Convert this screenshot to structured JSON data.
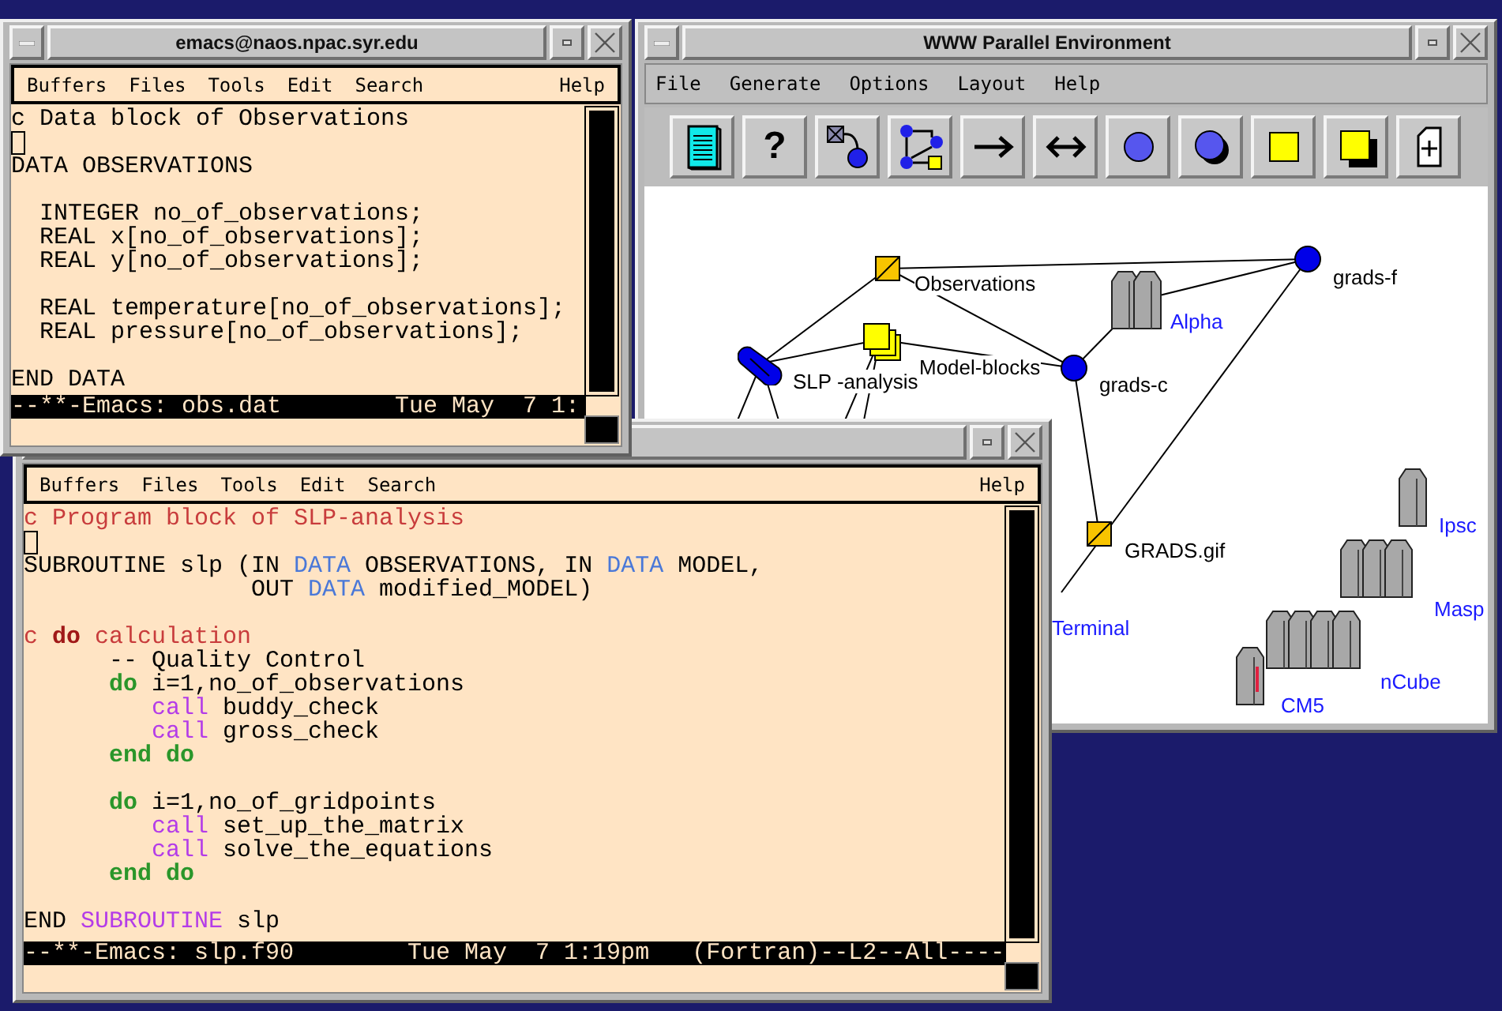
{
  "emacs_top": {
    "title": "emacs@naos.npac.syr.edu",
    "menu": [
      "Buffers",
      "Files",
      "Tools",
      "Edit",
      "Search"
    ],
    "help": "Help",
    "lines": [
      {
        "cursor": false,
        "segments": [
          {
            "kind": "text",
            "text": "c Data block of Observations"
          }
        ]
      },
      {
        "cursor": true
      },
      {
        "cursor": false,
        "segments": [
          {
            "kind": "text",
            "text": "DATA OBSERVATIONS"
          }
        ]
      },
      {
        "cursor": false
      },
      {
        "cursor": false,
        "segments": [
          {
            "kind": "text",
            "text": "  INTEGER no_of_observations;"
          }
        ]
      },
      {
        "cursor": false,
        "segments": [
          {
            "kind": "text",
            "text": "  REAL x[no_of_observations];"
          }
        ]
      },
      {
        "cursor": false,
        "segments": [
          {
            "kind": "text",
            "text": "  REAL y[no_of_observations];"
          }
        ]
      },
      {
        "cursor": false
      },
      {
        "cursor": false,
        "segments": [
          {
            "kind": "text",
            "text": "  REAL temperature[no_of_observations];"
          }
        ]
      },
      {
        "cursor": false,
        "segments": [
          {
            "kind": "text",
            "text": "  REAL pressure[no_of_observations];"
          }
        ]
      },
      {
        "cursor": false
      },
      {
        "cursor": false,
        "segments": [
          {
            "kind": "text",
            "text": "END DATA"
          }
        ]
      }
    ],
    "modeline": "--**-Emacs: obs.dat        Tue May  7 1:"
  },
  "wpe": {
    "title": "WWW Parallel Environment",
    "menu": [
      "File",
      "Generate",
      "Options",
      "Layout",
      "Help"
    ],
    "toolbar": [
      {
        "kind": "document"
      },
      {
        "kind": "help",
        "label": "?"
      },
      {
        "kind": "transform"
      },
      {
        "kind": "tree"
      },
      {
        "kind": "arrow"
      },
      {
        "kind": "double-arrow"
      },
      {
        "kind": "circle"
      },
      {
        "kind": "circle-shadow"
      },
      {
        "kind": "square"
      },
      {
        "kind": "square-shadow"
      },
      {
        "kind": "tag"
      }
    ],
    "nodes": [
      {
        "label": "Observations",
        "kind": "data"
      },
      {
        "label": "grads-f",
        "kind": "module"
      },
      {
        "label": "Alpha",
        "kind": "machine"
      },
      {
        "label": "SLP -analysis",
        "kind": "program"
      },
      {
        "label": "Model-blocks",
        "kind": "datastack"
      },
      {
        "label": "grads-c",
        "kind": "module"
      },
      {
        "label": "GRADS.gif",
        "kind": "data"
      },
      {
        "label": "Ipsc",
        "kind": "machine"
      },
      {
        "label": "Masp",
        "kind": "machine"
      },
      {
        "label": "Terminal",
        "kind": "link"
      },
      {
        "label": "nCube",
        "kind": "machine"
      },
      {
        "label": "CM5",
        "kind": "machine"
      }
    ]
  },
  "emacs_bottom": {
    "menu": [
      "Buffers",
      "Files",
      "Tools",
      "Edit",
      "Search"
    ],
    "help": "Help",
    "lines": [
      {
        "cursor": false,
        "segments": [
          {
            "kind": "comment",
            "text": "c Program block of SLP-analysis"
          }
        ]
      },
      {
        "cursor": true
      },
      {
        "cursor": false,
        "segments": [
          {
            "kind": "text",
            "text": "SUBROUTINE slp (IN "
          },
          {
            "kind": "type",
            "text": "DATA"
          },
          {
            "kind": "text",
            "text": " OBSERVATIONS, IN "
          },
          {
            "kind": "type",
            "text": "DATA"
          },
          {
            "kind": "text",
            "text": " MODEL,"
          }
        ]
      },
      {
        "cursor": false,
        "segments": [
          {
            "kind": "text",
            "text": "                OUT "
          },
          {
            "kind": "type",
            "text": "DATA"
          },
          {
            "kind": "text",
            "text": " modified_MODEL)"
          }
        ]
      },
      {
        "cursor": false
      },
      {
        "cursor": false,
        "segments": [
          {
            "kind": "comment",
            "text": "c "
          },
          {
            "kind": "comment-keyword",
            "text": "do"
          },
          {
            "kind": "comment",
            "text": " calculation"
          }
        ]
      },
      {
        "cursor": false,
        "segments": [
          {
            "kind": "text",
            "text": "      -- Quality Control"
          }
        ]
      },
      {
        "cursor": false,
        "segments": [
          {
            "kind": "keyword",
            "text": "      do"
          },
          {
            "kind": "text",
            "text": " i=1,no_of_observations"
          }
        ]
      },
      {
        "cursor": false,
        "segments": [
          {
            "kind": "builtin",
            "text": "         call"
          },
          {
            "kind": "text",
            "text": " buddy_check"
          }
        ]
      },
      {
        "cursor": false,
        "segments": [
          {
            "kind": "builtin",
            "text": "         call"
          },
          {
            "kind": "text",
            "text": " gross_check"
          }
        ]
      },
      {
        "cursor": false,
        "segments": [
          {
            "kind": "keyword",
            "text": "      end do"
          }
        ]
      },
      {
        "cursor": false
      },
      {
        "cursor": false,
        "segments": [
          {
            "kind": "keyword",
            "text": "      do"
          },
          {
            "kind": "text",
            "text": " i=1,no_of_gridpoints"
          }
        ]
      },
      {
        "cursor": false,
        "segments": [
          {
            "kind": "builtin",
            "text": "         call"
          },
          {
            "kind": "text",
            "text": " set_up_the_matrix"
          }
        ]
      },
      {
        "cursor": false,
        "segments": [
          {
            "kind": "builtin",
            "text": "         call"
          },
          {
            "kind": "text",
            "text": " solve_the_equations"
          }
        ]
      },
      {
        "cursor": false,
        "segments": [
          {
            "kind": "keyword",
            "text": "      end do"
          }
        ]
      },
      {
        "cursor": false
      },
      {
        "cursor": false,
        "segments": [
          {
            "kind": "text",
            "text": "END "
          },
          {
            "kind": "builtin",
            "text": "SUBROUTINE"
          },
          {
            "kind": "text",
            "text": " slp"
          }
        ]
      }
    ],
    "modeline": "--**-Emacs: slp.f90        Tue May  7 1:19pm   (Fortran)--L2--All----"
  }
}
